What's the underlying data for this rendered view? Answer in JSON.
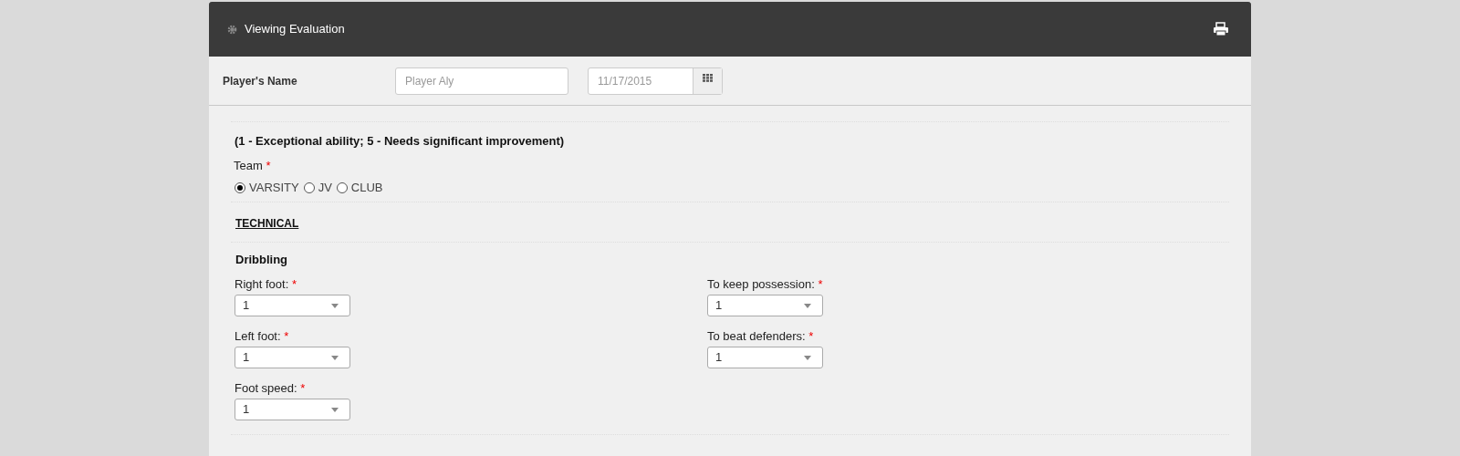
{
  "header": {
    "title": "Viewing Evaluation"
  },
  "player": {
    "label": "Player's Name",
    "name_placeholder": "Player Aly",
    "date": "11/17/2015"
  },
  "scale_note": "(1 - Exceptional ability; 5 - Needs significant improvement)",
  "team": {
    "label": "Team",
    "marker": "*",
    "options": [
      {
        "label": "VARSITY",
        "selected": true
      },
      {
        "label": "JV",
        "selected": false
      },
      {
        "label": "CLUB",
        "selected": false
      }
    ]
  },
  "section": "TECHNICAL",
  "group": "Dribbling",
  "columns": [
    [
      {
        "label": "Right foot:",
        "marker": "*",
        "value": "1"
      },
      {
        "label": "Left foot:",
        "marker": "*",
        "value": "1"
      },
      {
        "label": "Foot speed:",
        "marker": "*",
        "value": "1"
      }
    ],
    [
      {
        "label": "To keep possession:",
        "marker": "*",
        "value": "1"
      },
      {
        "label": "To beat defenders:",
        "marker": "*",
        "value": "1"
      }
    ]
  ]
}
